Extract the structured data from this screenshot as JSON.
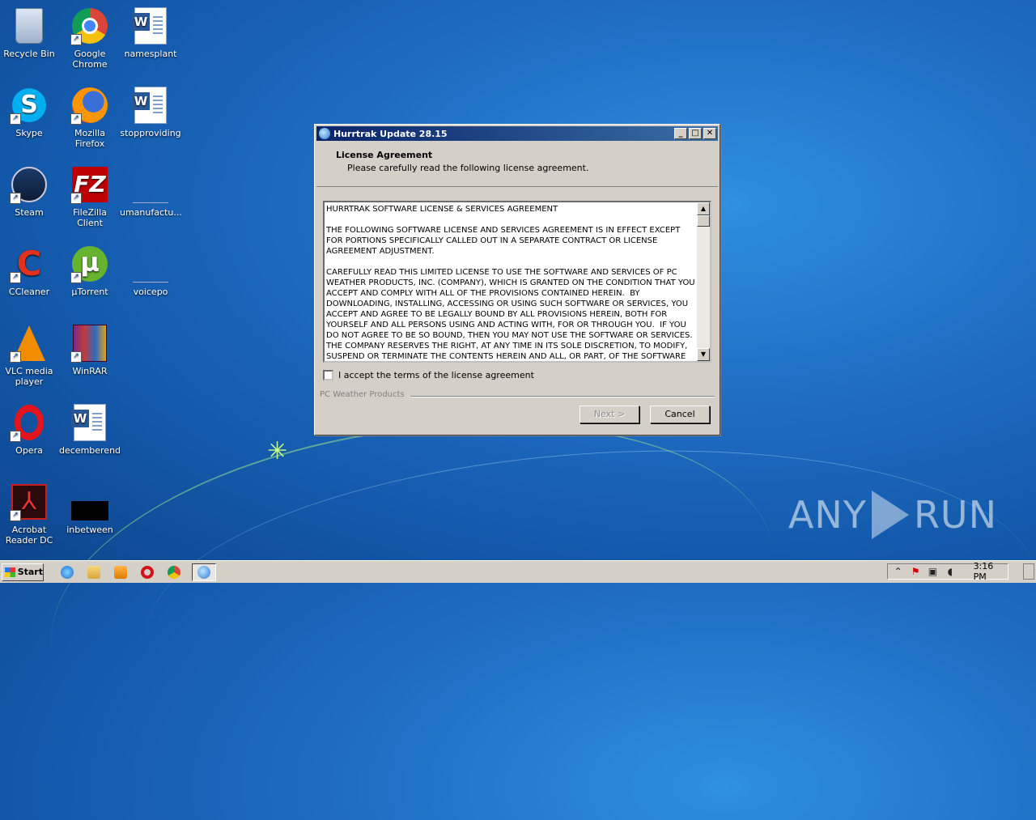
{
  "desktop": {
    "icons": [
      {
        "label": "Recycle Bin",
        "icon": "recycle-bin-icon"
      },
      {
        "label": "Google Chrome",
        "icon": "chrome-icon"
      },
      {
        "label": "namesplant",
        "icon": "word-doc-icon"
      },
      {
        "label": "Skype",
        "icon": "skype-icon"
      },
      {
        "label": "Mozilla Firefox",
        "icon": "firefox-icon"
      },
      {
        "label": "stopproviding",
        "icon": "word-doc-icon"
      },
      {
        "label": "Steam",
        "icon": "steam-icon"
      },
      {
        "label": "FileZilla Client",
        "icon": "filezilla-icon"
      },
      {
        "label": "umanufactu...",
        "icon": "blank-file-icon"
      },
      {
        "label": "CCleaner",
        "icon": "ccleaner-icon"
      },
      {
        "label": "µTorrent",
        "icon": "utorrent-icon"
      },
      {
        "label": "voicepo",
        "icon": "blank-file-icon"
      },
      {
        "label": "VLC media player",
        "icon": "vlc-icon"
      },
      {
        "label": "WinRAR",
        "icon": "winrar-icon"
      },
      {
        "label": "Opera",
        "icon": "opera-icon"
      },
      {
        "label": "decemberend",
        "icon": "word-doc-icon"
      },
      {
        "label": "Acrobat Reader DC",
        "icon": "acrobat-icon"
      },
      {
        "label": "inbetween",
        "icon": "black-file-icon"
      }
    ]
  },
  "dialog": {
    "title": "Hurrtrak Update 28.15",
    "header_title": "License Agreement",
    "header_subtitle": "Please carefully read the following license agreement.",
    "license_text": "HURRTRAK SOFTWARE LICENSE & SERVICES AGREEMENT\n\nTHE FOLLOWING SOFTWARE LICENSE AND SERVICES AGREEMENT IS IN EFFECT EXCEPT FOR PORTIONS SPECIFICALLY CALLED OUT IN A SEPARATE CONTRACT OR LICENSE AGREEMENT ADJUSTMENT.\n\nCAREFULLY READ THIS LIMITED LICENSE TO USE THE SOFTWARE AND SERVICES OF PC WEATHER PRODUCTS, INC. (COMPANY), WHICH IS GRANTED ON THE CONDITION THAT YOU ACCEPT AND COMPLY WITH ALL OF THE PROVISIONS CONTAINED HEREIN.  BY DOWNLOADING, INSTALLING, ACCESSING OR USING SUCH SOFTWARE OR SERVICES, YOU ACCEPT AND AGREE TO BE LEGALLY BOUND BY ALL PROVISIONS HEREIN, BOTH FOR YOURSELF AND ALL PERSONS USING AND ACTING WITH, FOR OR THROUGH YOU.  IF YOU DO NOT AGREE TO BE SO BOUND, THEN YOU MAY NOT USE THE SOFTWARE OR SERVICES. THE COMPANY RESERVES THE RIGHT, AT ANY TIME IN ITS SOLE DISCRETION, TO MODIFY, SUSPEND OR TERMINATE THE CONTENTS HEREIN AND ALL, OR PART, OF THE SOFTWARE",
    "accept_label": "I accept the terms of the license agreement",
    "accept_checked": false,
    "branding": "PC Weather Products",
    "next_label": "Next >",
    "cancel_label": "Cancel",
    "minimize_glyph": "_",
    "maximize_glyph": "□",
    "close_glyph": "✕"
  },
  "taskbar": {
    "start_label": "Start",
    "pinned": [
      "internet-explorer-icon",
      "file-explorer-icon",
      "media-player-icon",
      "opera-icon",
      "chrome-icon",
      "hurrtrak-setup-icon"
    ],
    "clock": "3:16 PM",
    "tray_show_hidden": "⌃"
  },
  "watermark": {
    "left": "ANY",
    "right": "RUN"
  }
}
